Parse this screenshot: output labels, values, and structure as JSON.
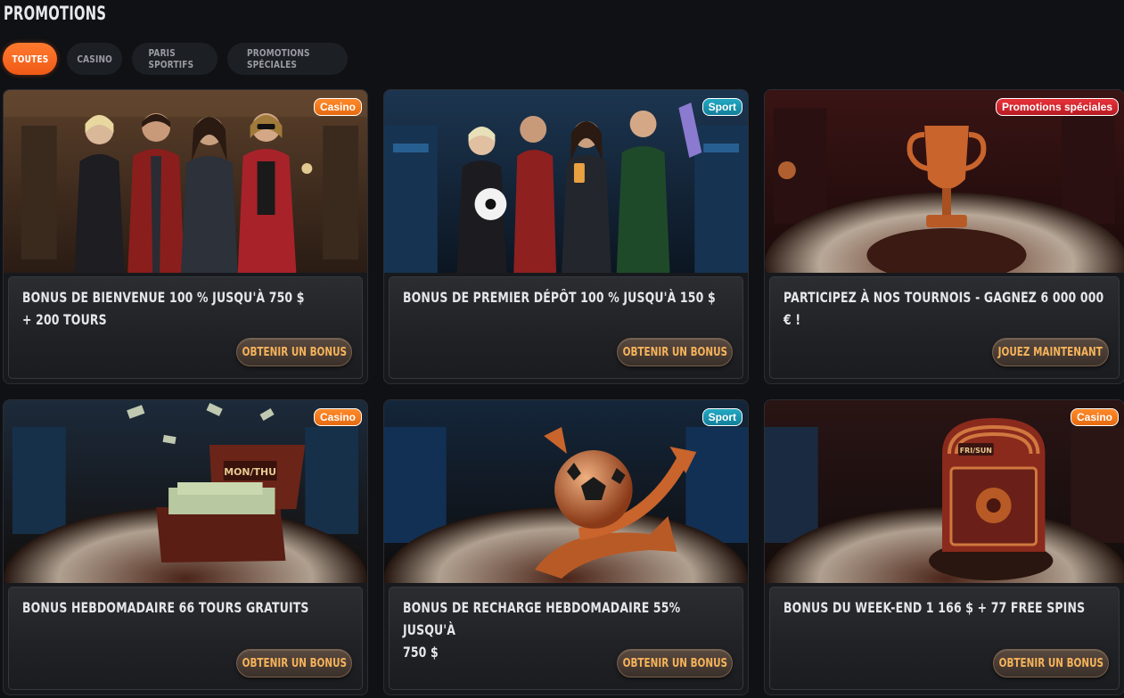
{
  "page": {
    "title": "PROMOTIONS"
  },
  "tabs": [
    {
      "label": "TOUTES",
      "active": true
    },
    {
      "label": "CASINO",
      "active": false
    },
    {
      "label": "PARIS SPORTIFS",
      "active": false
    },
    {
      "label": "PROMOTIONS SPÉCIALES",
      "active": false
    }
  ],
  "colors": {
    "accent": "#f05a16",
    "badge_casino": "#f07a1c",
    "badge_sport": "#1a95b0",
    "badge_special": "#d0262e",
    "button_text": "#f6b35a"
  },
  "promotions": [
    {
      "badge": "Casino",
      "category": "casino",
      "image": "casino-hosts-illustration",
      "line1": "BONUS DE BIENVENUE 100 % JUSQU'À 750 $",
      "line2": "+ 200 TOURS",
      "button": "OBTENIR UN BONUS"
    },
    {
      "badge": "Sport",
      "category": "sport",
      "image": "sport-fans-illustration",
      "line1": "BONUS DE PREMIER DÉPÔT 100 % JUSQU'À 150 $",
      "line2": "",
      "button": "OBTENIR UN BONUS"
    },
    {
      "badge": "Promotions spéciales",
      "category": "special",
      "image": "tournament-trophy-illustration",
      "line1": "PARTICIPEZ À NOS TOURNOIS - GAGNEZ 6 000 000 € !",
      "line2": "",
      "button": "JOUEZ MAINTENANT"
    },
    {
      "badge": "Casino",
      "category": "casino",
      "image": "money-chest-illustration",
      "chest_label": "MON/THU",
      "line1": "BONUS HEBDOMADAIRE 66 TOURS GRATUITS",
      "line2": "",
      "button": "OBTENIR UN BONUS"
    },
    {
      "badge": "Sport",
      "category": "sport",
      "image": "football-arrow-illustration",
      "line1": "BONUS DE RECHARGE HEBDOMADAIRE 55% JUSQU'À",
      "line2": "750 $",
      "button": "OBTENIR UN BONUS"
    },
    {
      "badge": "Casino",
      "category": "casino",
      "image": "weekend-safe-illustration",
      "safe_label": "FRI/SUN",
      "line1": "BONUS DU WEEK-END 1 166 $ + 77 FREE SPINS",
      "line2": "",
      "button": "OBTENIR UN BONUS"
    }
  ]
}
